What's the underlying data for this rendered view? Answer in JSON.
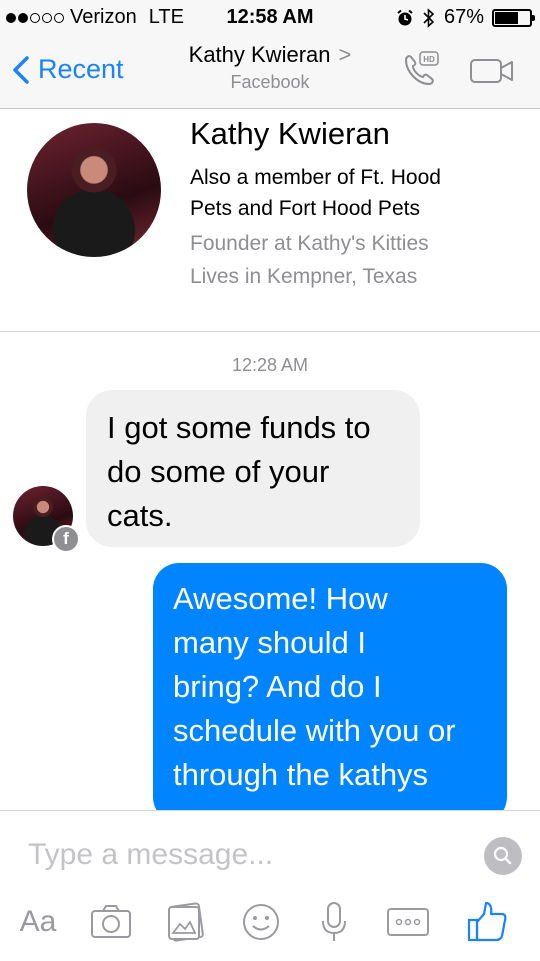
{
  "status_bar": {
    "carrier": "Verizon",
    "network": "LTE",
    "time": "12:58 AM",
    "battery_percent": "67%",
    "battery_level": 0.67,
    "signal_bars_filled": 2,
    "signal_bars_total": 5
  },
  "nav": {
    "back_label": "Recent",
    "title": "Kathy Kwieran",
    "title_chevron": ">",
    "subtitle": "Facebook",
    "call_icon": "phone-hd-icon",
    "video_icon": "video-camera-icon"
  },
  "profile": {
    "name": "Kathy Kwieran",
    "line1": "Also a member of Ft. Hood",
    "line2": "Pets and Fort Hood Pets",
    "line3": "Founder at Kathy's Kitties",
    "line4": "Lives in Kempner, Texas"
  },
  "conversation": {
    "timestamp": "12:28 AM",
    "messages": [
      {
        "direction": "incoming",
        "lines": [
          "I got some funds to",
          "do some of your",
          "cats."
        ]
      },
      {
        "direction": "outgoing",
        "lines": [
          "Awesome! How",
          "many should I",
          "bring? And do I",
          "schedule with you or",
          "through the kathys"
        ]
      }
    ],
    "badge_letter": "f"
  },
  "composer": {
    "placeholder": "Type a message...",
    "text_format_label": "Aa",
    "tools": [
      "text-format",
      "camera-icon",
      "gallery-icon",
      "emoji-icon",
      "microphone-icon",
      "more-icon",
      "like-icon"
    ]
  },
  "colors": {
    "accent": "#1a82fb",
    "outgoing_bubble": "#0084ff",
    "incoming_bubble": "#f1f0f0",
    "muted_text": "#8e8e93"
  }
}
